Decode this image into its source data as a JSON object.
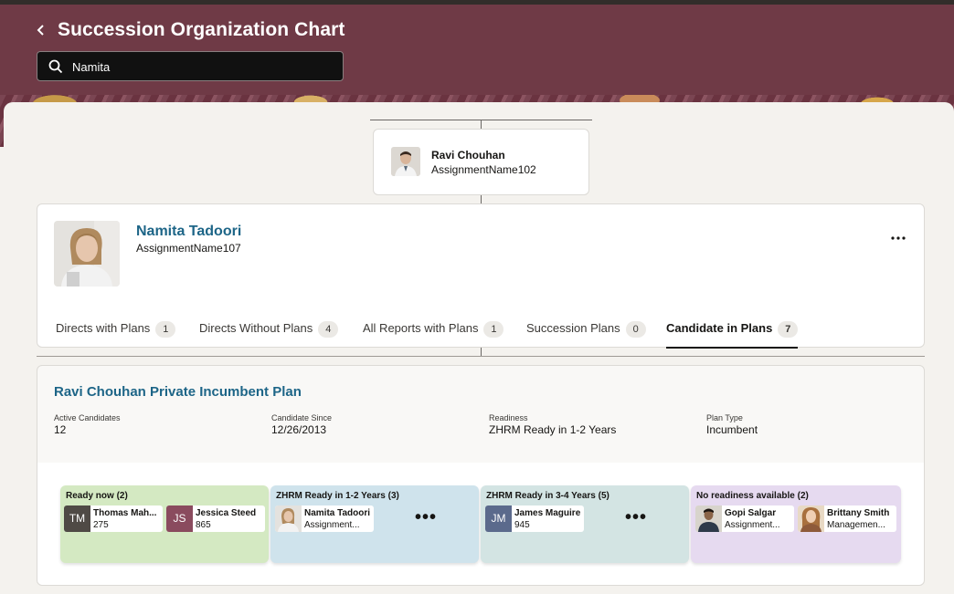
{
  "header": {
    "title": "Succession Organization Chart",
    "search": {
      "value": "Namita",
      "placeholder": ""
    }
  },
  "manager": {
    "name": "Ravi Chouhan",
    "assignment": "AssignmentName102"
  },
  "focus": {
    "name": "Namita Tadoori",
    "assignment": "AssignmentName107",
    "more_label": "..."
  },
  "tabs": [
    {
      "label": "Directs with Plans",
      "count": "1"
    },
    {
      "label": "Directs Without Plans",
      "count": "4"
    },
    {
      "label": "All Reports with Plans",
      "count": "1"
    },
    {
      "label": "Succession Plans",
      "count": "0"
    },
    {
      "label": "Candidate in Plans",
      "count": "7"
    }
  ],
  "plan": {
    "title": "Ravi Chouhan Private Incumbent Plan",
    "meta": [
      {
        "label": "Active Candidates",
        "value": "12"
      },
      {
        "label": "Candidate Since",
        "value": "12/26/2013"
      },
      {
        "label": "Readiness",
        "value": "ZHRM Ready in 1-2 Years"
      },
      {
        "label": "Plan Type",
        "value": "Incumbent"
      }
    ]
  },
  "lanes": [
    {
      "title": "Ready now (2)",
      "color": "#d4e9c2",
      "candidates": [
        {
          "initials": "TM",
          "name": "Thomas Mah...",
          "sub": "275",
          "color": "#4f4a45"
        },
        {
          "initials": "JS",
          "name": "Jessica Steed",
          "sub": "865",
          "color": "#8a4b5e"
        }
      ]
    },
    {
      "title": "ZHRM Ready in 1-2 Years (3)",
      "color": "#cfe3ec",
      "candidates": [
        {
          "initials": "",
          "name": "Namita Tadoori",
          "sub": "Assignment...",
          "color": "#c9c2b8"
        }
      ],
      "more": "•••"
    },
    {
      "title": "ZHRM Ready in 3-4 Years (5)",
      "color": "#d3e4e3",
      "candidates": [
        {
          "initials": "JM",
          "name": "James Maguire",
          "sub": "945",
          "color": "#5b6a8c"
        }
      ],
      "more": "•••"
    },
    {
      "title": "No readiness available (2)",
      "color": "#e6daf0",
      "candidates": [
        {
          "initials": "",
          "name": "Gopi Salgar",
          "sub": "Assignment...",
          "color": "#5a4a3a"
        },
        {
          "initials": "",
          "name": "Brittany Smith",
          "sub": "Managemen...",
          "color": "#a8703e"
        }
      ]
    }
  ],
  "colors": {
    "header": "#6f3a46",
    "link": "#1d6587"
  }
}
